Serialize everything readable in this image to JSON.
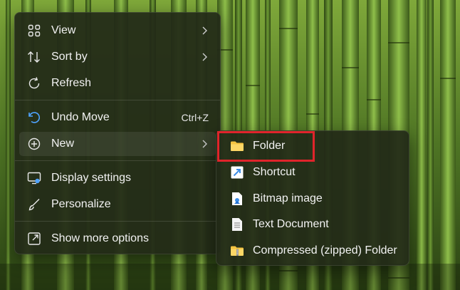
{
  "context_menu": {
    "items": [
      {
        "label": "View",
        "icon": "grid-icon",
        "has_submenu": true
      },
      {
        "label": "Sort by",
        "icon": "sort-icon",
        "has_submenu": true
      },
      {
        "label": "Refresh",
        "icon": "refresh-icon"
      },
      {
        "label": "Undo Move",
        "icon": "undo-icon",
        "shortcut": "Ctrl+Z"
      },
      {
        "label": "New",
        "icon": "plus-circle-icon",
        "has_submenu": true
      },
      {
        "label": "Display settings",
        "icon": "display-icon"
      },
      {
        "label": "Personalize",
        "icon": "brush-icon"
      },
      {
        "label": "Show more options",
        "icon": "share-icon"
      }
    ]
  },
  "new_submenu": {
    "items": [
      {
        "label": "Folder",
        "icon": "folder-icon"
      },
      {
        "label": "Shortcut",
        "icon": "shortcut-icon"
      },
      {
        "label": "Bitmap image",
        "icon": "bitmap-icon"
      },
      {
        "label": "Text Document",
        "icon": "text-document-icon"
      },
      {
        "label": "Compressed (zipped) Folder",
        "icon": "zip-folder-icon"
      }
    ]
  },
  "colors": {
    "highlight_border": "#e0242b",
    "folder_yellow": "#f5c542",
    "shortcut_blue": "#3d8ee6"
  }
}
